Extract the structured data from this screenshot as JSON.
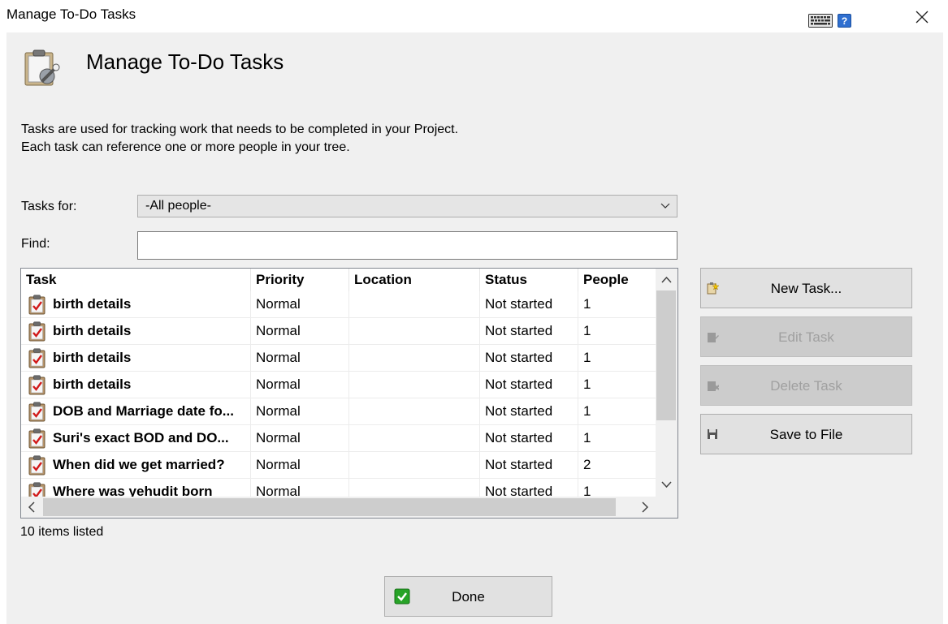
{
  "window": {
    "title": "Manage To-Do Tasks",
    "help_label": "?"
  },
  "header": {
    "title": "Manage To-Do Tasks",
    "description_line1": "Tasks are used for tracking work that needs to be completed in your Project.",
    "description_line2": "Each task can reference one or more people in your tree."
  },
  "filters": {
    "tasks_for_label": "Tasks for:",
    "tasks_for_value": "-All people-",
    "find_label": "Find:",
    "find_value": ""
  },
  "table": {
    "columns": [
      "Task",
      "Priority",
      "Location",
      "Status",
      "People"
    ],
    "rows": [
      {
        "task": "birth details",
        "priority": "Normal",
        "location": "",
        "status": "Not started",
        "people": "1"
      },
      {
        "task": "birth details",
        "priority": "Normal",
        "location": "",
        "status": "Not started",
        "people": "1"
      },
      {
        "task": "birth details",
        "priority": "Normal",
        "location": "",
        "status": "Not started",
        "people": "1"
      },
      {
        "task": "birth details",
        "priority": "Normal",
        "location": "",
        "status": "Not started",
        "people": "1"
      },
      {
        "task": "DOB and Marriage date fo...",
        "priority": "Normal",
        "location": "",
        "status": "Not started",
        "people": "1"
      },
      {
        "task": "Suri's exact BOD and DO...",
        "priority": "Normal",
        "location": "",
        "status": "Not started",
        "people": "1"
      },
      {
        "task": "When did we get married?",
        "priority": "Normal",
        "location": "",
        "status": "Not started",
        "people": "2"
      },
      {
        "task": "Where was yehudit born",
        "priority": "Normal",
        "location": "",
        "status": "Not started",
        "people": "1"
      }
    ]
  },
  "buttons": {
    "new_task": "New Task...",
    "edit_task": "Edit Task",
    "delete_task": "Delete Task",
    "save_to_file": "Save to File",
    "done": "Done"
  },
  "status_text": "10 items listed",
  "icons": {
    "header": "clipboard-wrench-icon",
    "task_row": "clipboard-check-icon",
    "done": "green-check-icon"
  }
}
